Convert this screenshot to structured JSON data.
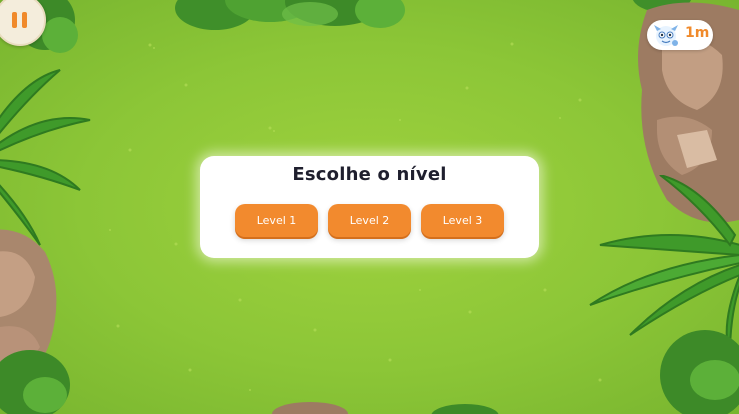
{
  "hud": {
    "pause_icon": "pause-icon",
    "timer": "1m",
    "mascot_icon": "mascot-icon"
  },
  "level_select": {
    "title": "Escolhe o nível",
    "levels": [
      {
        "label": "Level 1"
      },
      {
        "label": "Level 2"
      },
      {
        "label": "Level 3"
      }
    ]
  },
  "colors": {
    "background_grass": "#8cc637",
    "accent_orange": "#f28a2e",
    "panel_bg": "#ffffff",
    "title_text": "#1f1f2e"
  }
}
